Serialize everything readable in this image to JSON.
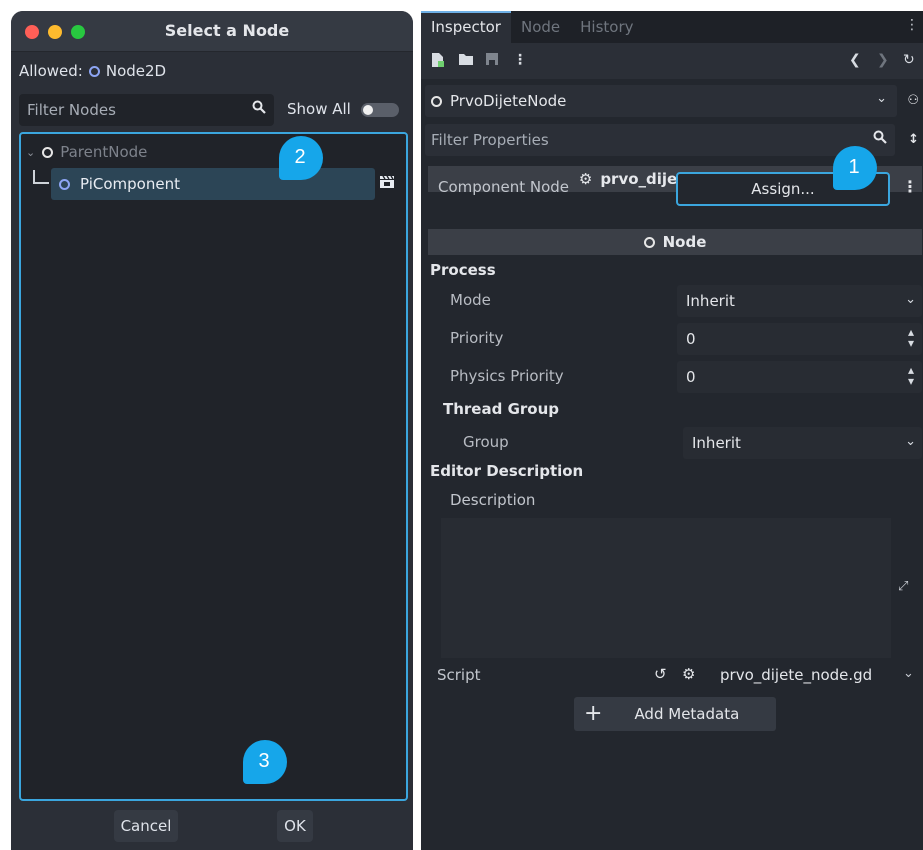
{
  "dialog": {
    "title": "Select a Node",
    "allowed_label": "Allowed:",
    "allowed_type": "Node2D",
    "filter_placeholder": "Filter Nodes",
    "show_all_label": "Show All",
    "tree": {
      "parent": "ParentNode",
      "child": "PiComponent"
    },
    "cancel_label": "Cancel",
    "ok_label": "OK"
  },
  "markers": {
    "one": "1",
    "two": "2",
    "three": "3"
  },
  "inspector": {
    "tabs": [
      "Inspector",
      "Node",
      "History"
    ],
    "node_path": "PrvoDijeteNode",
    "filter_placeholder": "Filter Properties",
    "script_section": "prvo_dijete_node.gd",
    "component_label": "Component Node",
    "assign_label": "Assign...",
    "node_section": "Node",
    "process": {
      "header": "Process",
      "mode_label": "Mode",
      "mode_value": "Inherit",
      "priority_label": "Priority",
      "priority_value": "0",
      "physics_priority_label": "Physics Priority",
      "physics_priority_value": "0"
    },
    "thread_group": {
      "header": "Thread Group",
      "group_label": "Group",
      "group_value": "Inherit"
    },
    "editor_description": {
      "header": "Editor Description",
      "description_label": "Description"
    },
    "script_label": "Script",
    "script_value": "prvo_dijete_node.gd",
    "add_metadata_label": "Add Metadata"
  },
  "colors": {
    "accent": "#3ba6de",
    "marker": "#16a6ea",
    "node_icon": "#8da5f3"
  }
}
